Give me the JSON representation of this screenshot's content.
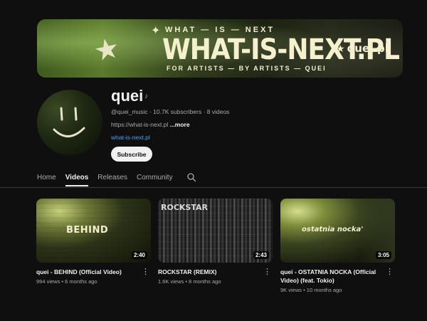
{
  "banner": {
    "top_text": "WHAT — IS — NEXT",
    "title": "WHAT-IS-NEXT.PL",
    "bottom_text": "FOR ARTISTS — BY ARTISTS — QUEI",
    "logo_text": "quei.pl",
    "star_icon": "star-icon"
  },
  "channel": {
    "name": "quei",
    "name_icon": "music-note-icon",
    "handle_stats": "@quei_music · 10.7K subscribers · 8 videos",
    "description": "https://what-is-next.pl",
    "more_label": "...more",
    "link": "what-is-next.pl",
    "subscribe_label": "Subscribe"
  },
  "tabs": [
    {
      "label": "Home",
      "active": false
    },
    {
      "label": "Videos",
      "active": true
    },
    {
      "label": "Releases",
      "active": false
    },
    {
      "label": "Community",
      "active": false
    }
  ],
  "search_icon": "search-icon",
  "videos": [
    {
      "thumb_text": "BEHIND",
      "duration": "2:40",
      "title": "quei - BEHIND (Official Video)",
      "meta": "994 views • 6 months ago"
    },
    {
      "thumb_text": "ROCKSTAR",
      "duration": "2:43",
      "title": "ROCKSTAR (REMIX)",
      "meta": "1.6K views • 8 months ago"
    },
    {
      "thumb_text": "ostatnia nocka'",
      "duration": "3:05",
      "title": "quei - OSTATNIA NOCKA (Official Video) (feat. Tokio)",
      "meta": "9K views • 10 months ago"
    }
  ],
  "colors": {
    "background": "#0f0f0f",
    "link": "#3ea6ff",
    "banner_green": "#5b7a2c"
  }
}
